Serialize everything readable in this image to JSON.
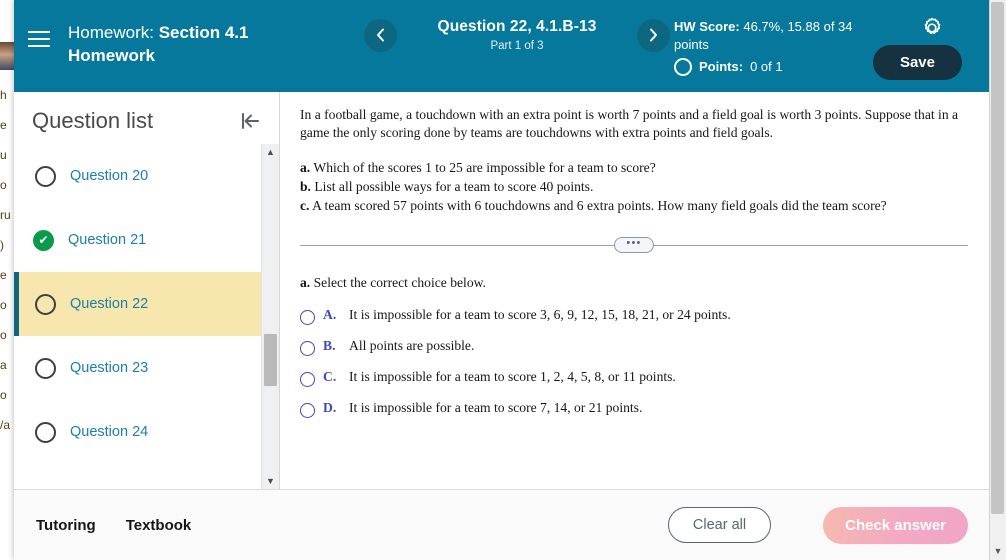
{
  "header": {
    "menu_icon": "hamburger-icon",
    "assignment_prefix": "Homework:",
    "assignment_name": "Section 4.1 Homework",
    "prev_icon": "chevron-left-icon",
    "next_icon": "chevron-right-icon",
    "question_title": "Question 22, 4.1.B-13",
    "part_label": "Part 1 of 3",
    "hw_score_label": "HW Score:",
    "hw_score_value": "46.7%, 15.88 of 34 points",
    "points_label": "Points:",
    "points_value": "0 of 1",
    "settings_icon": "gear-icon",
    "save_label": "Save",
    "bg_color": "#06789c",
    "save_bg_color": "#16313f"
  },
  "sidebar": {
    "title": "Question list",
    "collapse_icon": "collapse-left-icon",
    "scroll_up_icon": "triangle-up-icon",
    "scroll_down_icon": "triangle-down-icon",
    "current_highlight_color": "#f7e6ad",
    "items": [
      {
        "label": "Question 20",
        "state": "unanswered",
        "current": false
      },
      {
        "label": "Question 21",
        "state": "correct",
        "current": false
      },
      {
        "label": "Question 22",
        "state": "unanswered",
        "current": true
      },
      {
        "label": "Question 23",
        "state": "unanswered",
        "current": false
      },
      {
        "label": "Question 24",
        "state": "unanswered",
        "current": false
      }
    ]
  },
  "content": {
    "stem": "In a football game, a touchdown with an extra point is worth 7 points and a field goal is worth 3 points. Suppose that in a game the only scoring done by teams are touchdowns with extra points and field goals.",
    "subparts": [
      {
        "label": "a.",
        "text": "Which of the scores 1 to 25 are impossible for a team to score?"
      },
      {
        "label": "b.",
        "text": "List all possible ways for a team to score 40 points."
      },
      {
        "label": "c.",
        "text": "A team scored 57 points with 6 touchdowns and 6 extra points. How many field goals did the team score?"
      }
    ],
    "divider_pill_label": "•••",
    "prompt_label": "a.",
    "prompt_text": "Select the correct choice below.",
    "choices": [
      {
        "letter": "A.",
        "text": "It is impossible for a team to score 3, 6, 9, 12, 15, 18, 21, or 24 points.",
        "selected": false
      },
      {
        "letter": "B.",
        "text": "All points are possible.",
        "selected": false
      },
      {
        "letter": "C.",
        "text": "It is impossible for a team to score 1, 2, 4, 5, 8, or 11 points.",
        "selected": false
      },
      {
        "letter": "D.",
        "text": "It is impossible for a team to score 7, 14, or 21 points.",
        "selected": false
      }
    ]
  },
  "footer": {
    "tutoring_label": "Tutoring",
    "textbook_label": "Textbook",
    "clear_all_label": "Clear all",
    "check_answer_label": "Check answer"
  },
  "window": {
    "scroll_down_icon": "triangle-down-icon"
  }
}
